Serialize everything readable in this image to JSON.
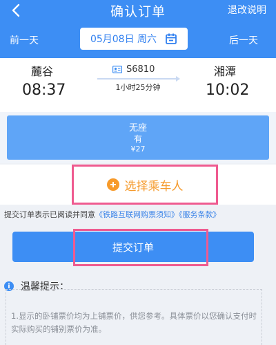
{
  "header": {
    "title": "确认订单",
    "refund_link": "退改说明",
    "prev_day": "前一天",
    "next_day": "后一天",
    "date": "05月08日 周六"
  },
  "train": {
    "departure_station": "麓谷",
    "departure_time": "08:37",
    "arrival_station": "湘潭",
    "arrival_time": "10:02",
    "train_no": "S6810",
    "duration": "1小时25分钟"
  },
  "seat": {
    "type": "无座",
    "availability": "有",
    "price": "¥27"
  },
  "passenger": {
    "select_label": "选择乘车人"
  },
  "agreement": {
    "prefix": "提交订单表示已阅读并同意",
    "link1": "《铁路互联网购票须知》",
    "link2": "《服务条款》"
  },
  "submit": {
    "label": "提交订单"
  },
  "tips": {
    "title": "温馨提示：",
    "text": "1.显示的卧铺票价均为上铺票价，供您参考。具体票价以您确认支付时实际购买的铺别票价为准。"
  },
  "colors": {
    "primary": "#3d8ef4",
    "seat_card": "#5fa5f7",
    "accent_orange": "#f59a2b",
    "highlight_pink": "#ef5b90"
  }
}
